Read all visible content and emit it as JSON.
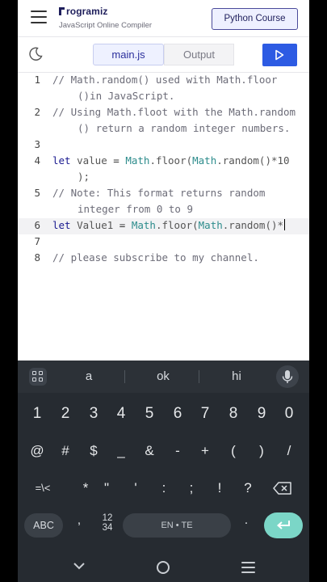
{
  "header": {
    "brand": "rogramiz",
    "subtitle": "JavaScript Online Compiler",
    "cta_label": "Python Course"
  },
  "toolbar": {
    "tabs": [
      {
        "label": "main.js",
        "active": true
      },
      {
        "label": "Output",
        "active": false
      }
    ],
    "theme_icon": "moon-icon",
    "run_icon": "play-icon"
  },
  "editor": {
    "lines": [
      {
        "num": "1",
        "parts": [
          "// Math.random() used with Math.floor",
          "()in JavaScript."
        ]
      },
      {
        "num": "2",
        "parts": [
          "// Using Math.floot with the Math.random",
          "() return a random integer numbers."
        ]
      },
      {
        "num": "3",
        "parts": [
          ""
        ]
      },
      {
        "num": "4",
        "parts": [
          "let value = Math.floor(Math.random()*10",
          ");"
        ]
      },
      {
        "num": "5",
        "parts": [
          "// Note: This format returns random",
          "integer from 0 to 9"
        ]
      },
      {
        "num": "6",
        "parts": [
          "let Value1 = Math.floor(Math.random()*"
        ]
      },
      {
        "num": "7",
        "parts": [
          ""
        ]
      },
      {
        "num": "8",
        "parts": [
          "// please subscribe to my channel."
        ]
      }
    ],
    "active_line": 6
  },
  "keyboard": {
    "suggestions": [
      "a",
      "ok",
      "hi"
    ],
    "numbers": [
      "1",
      "2",
      "3",
      "4",
      "5",
      "6",
      "7",
      "8",
      "9",
      "0"
    ],
    "symbols_row1": [
      "@",
      "#",
      "$",
      "_",
      "&",
      "-",
      "+",
      "(",
      ")",
      "/"
    ],
    "symbols_row2": [
      "=\\<",
      "*",
      "\"",
      "'",
      ":",
      ";",
      "!",
      "?"
    ],
    "abc": "ABC",
    "comma": ",",
    "numpad_top": "12",
    "numpad_bottom": "34",
    "space": "EN • TE",
    "period": "."
  },
  "colors": {
    "accent": "#2d5be3",
    "enter": "#7bd6c7",
    "keyboard_bg": "#262b31"
  }
}
